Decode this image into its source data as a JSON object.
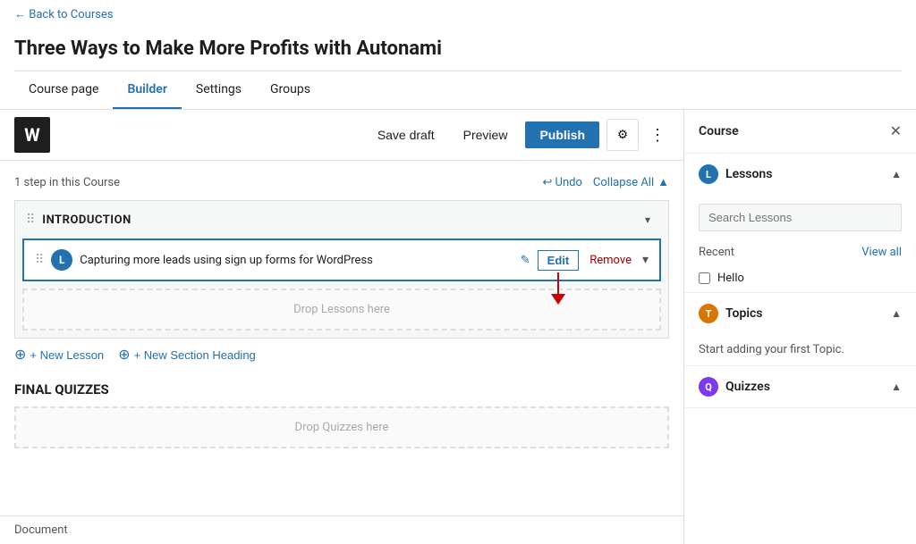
{
  "back_link": "← Back to Courses",
  "page_title": "Three Ways to Make More Profits with Autonami",
  "tabs": [
    {
      "id": "course-page",
      "label": "Course page",
      "active": false
    },
    {
      "id": "builder",
      "label": "Builder",
      "active": true
    },
    {
      "id": "settings",
      "label": "Settings",
      "active": false
    },
    {
      "id": "groups",
      "label": "Groups",
      "active": false
    }
  ],
  "toolbar": {
    "wp_logo": "W",
    "save_draft_label": "Save draft",
    "preview_label": "Preview",
    "publish_label": "Publish",
    "gear_icon": "⚙",
    "more_icon": "⋮"
  },
  "builder": {
    "step_count": "1 step in this Course",
    "undo_label": "↩ Undo",
    "collapse_all_label": "Collapse All",
    "section_title": "INTRODUCTION",
    "lesson": {
      "icon_letter": "L",
      "title": "Capturing more leads using sign up forms for WordPress",
      "edit_label": "Edit",
      "remove_label": "Remove"
    },
    "drop_lessons_label": "Drop Lessons here",
    "add_new_lesson_label": "+ New Lesson",
    "add_new_section_label": "+ New Section Heading",
    "final_quizzes_title": "FINAL QUIZZES",
    "drop_quizzes_label": "Drop Quizzes here"
  },
  "sidebar": {
    "title": "Course",
    "close_icon": "✕",
    "sections": [
      {
        "id": "lessons",
        "icon_letter": "L",
        "icon_color": "#2271b1",
        "label": "Lessons",
        "search_placeholder": "Search Lessons",
        "recent_label": "Recent",
        "view_all_label": "View all",
        "items": [
          {
            "label": "Hello"
          }
        ],
        "empty_msg": null
      },
      {
        "id": "topics",
        "icon_letter": "T",
        "icon_color": "#d97706",
        "label": "Topics",
        "empty_msg": "Start adding your first Topic."
      },
      {
        "id": "quizzes",
        "icon_letter": "Q",
        "icon_color": "#7c3aed",
        "label": "Quizzes",
        "empty_msg": null
      }
    ]
  },
  "bottom_bar": {
    "label": "Document"
  }
}
